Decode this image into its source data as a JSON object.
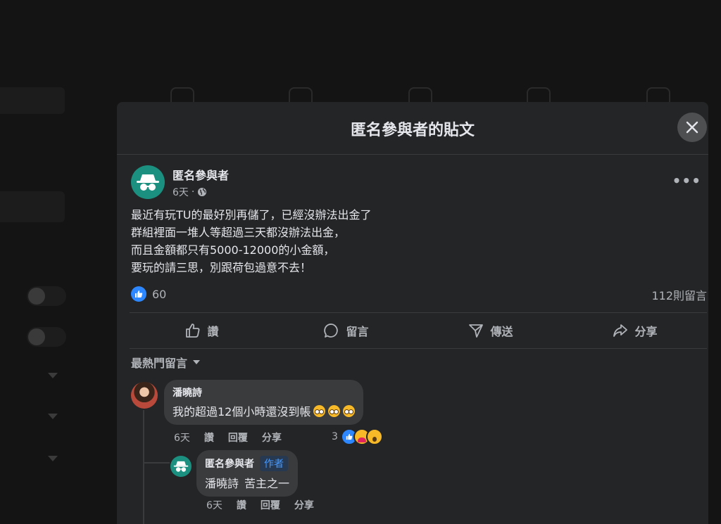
{
  "post_dialog": {
    "title": "匿名參與者的貼文",
    "author": "匿名參與者",
    "time": "6天",
    "separator": "·",
    "body_lines": [
      "最近有玩TU的最好別再儲了，已經沒辦法出金了",
      "群組裡面一堆人等超過三天都沒辦法出金，",
      "而且金額都只有5000-12000的小金額，",
      "要玩的請三思，別跟荷包過意不去！"
    ],
    "reaction_count": "60",
    "comment_count": "112則留言",
    "more_icon_glyph": "•••"
  },
  "actions": {
    "like": "讚",
    "comment": "留言",
    "send": "傳送",
    "share": "分享"
  },
  "comments_sort": "最熱門留言",
  "comments": [
    {
      "author": "潘曉詩",
      "text": "我的超過12個小時還沒到帳",
      "emoji_count": 3,
      "time": "6天",
      "like_label": "讚",
      "reply_label": "回覆",
      "share_label": "分享",
      "reaction_count": "3"
    }
  ],
  "reply": {
    "author": "匿名參與者",
    "badge": "作者",
    "mention": "潘曉詩",
    "text": "苦主之一",
    "time": "6天",
    "like_label": "讚",
    "reply_label": "回覆",
    "share_label": "分享"
  },
  "colors": {
    "accent": "#2d88ff",
    "anon_avatar": "#1b8f80",
    "modal_bg": "#242526",
    "bubble_bg": "#3a3b3c"
  }
}
